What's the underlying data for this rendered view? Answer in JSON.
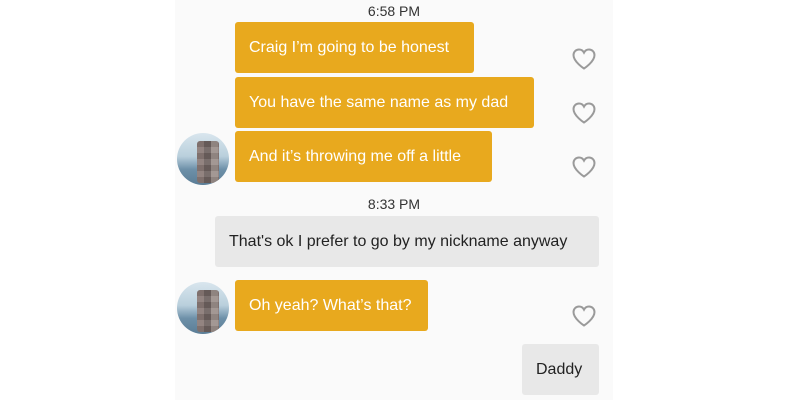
{
  "conversation": {
    "timestamp_1": "6:58 PM",
    "messages_block_1": [
      "Craig I’m going to be honest",
      "You have the same name as my dad",
      "And it’s throwing me off a little"
    ],
    "timestamp_2": "8:33 PM",
    "reply_1": "That's ok I prefer to go by my nickname anyway",
    "message_block_2": "Oh yeah? What’s that?",
    "reply_2": "Daddy"
  },
  "colors": {
    "incoming_bubble": "#e8a91e",
    "outgoing_bubble": "#e8e8e8",
    "heart_outline": "#9a9a9a"
  },
  "icons": {
    "like": "heart-outline-icon"
  }
}
